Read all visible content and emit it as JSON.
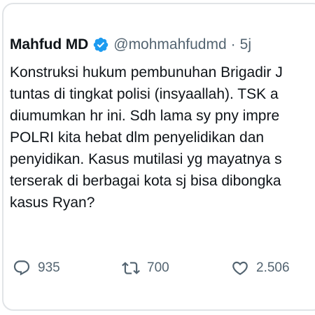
{
  "tweet": {
    "display_name": "Mahfud MD",
    "handle": "@mohmahfudmd",
    "separator": "·",
    "time_ago": "5j",
    "text_lines": [
      "Konstruksi hukum pembunuhan Brigadir J",
      "tuntas di tingkat polisi (insyaallah). TSK a",
      "diumumkan hr ini. Sdh lama sy pny impre",
      "POLRI kita  hebat dlm penyelidikan dan",
      "penyidikan. Kasus mutilasi yg mayatnya s",
      "terserak di berbagai kota sj bisa dibongka",
      "kasus Ryan?"
    ],
    "actions": {
      "reply_count": "935",
      "retweet_count": "700",
      "like_count": "2.506"
    }
  },
  "icons": {
    "verified": "verified-badge-icon",
    "reply": "reply-icon",
    "retweet": "retweet-icon",
    "like": "heart-icon"
  },
  "colors": {
    "verified_blue": "#1d9bf0",
    "text": "#0f1419",
    "secondary": "#536471"
  }
}
